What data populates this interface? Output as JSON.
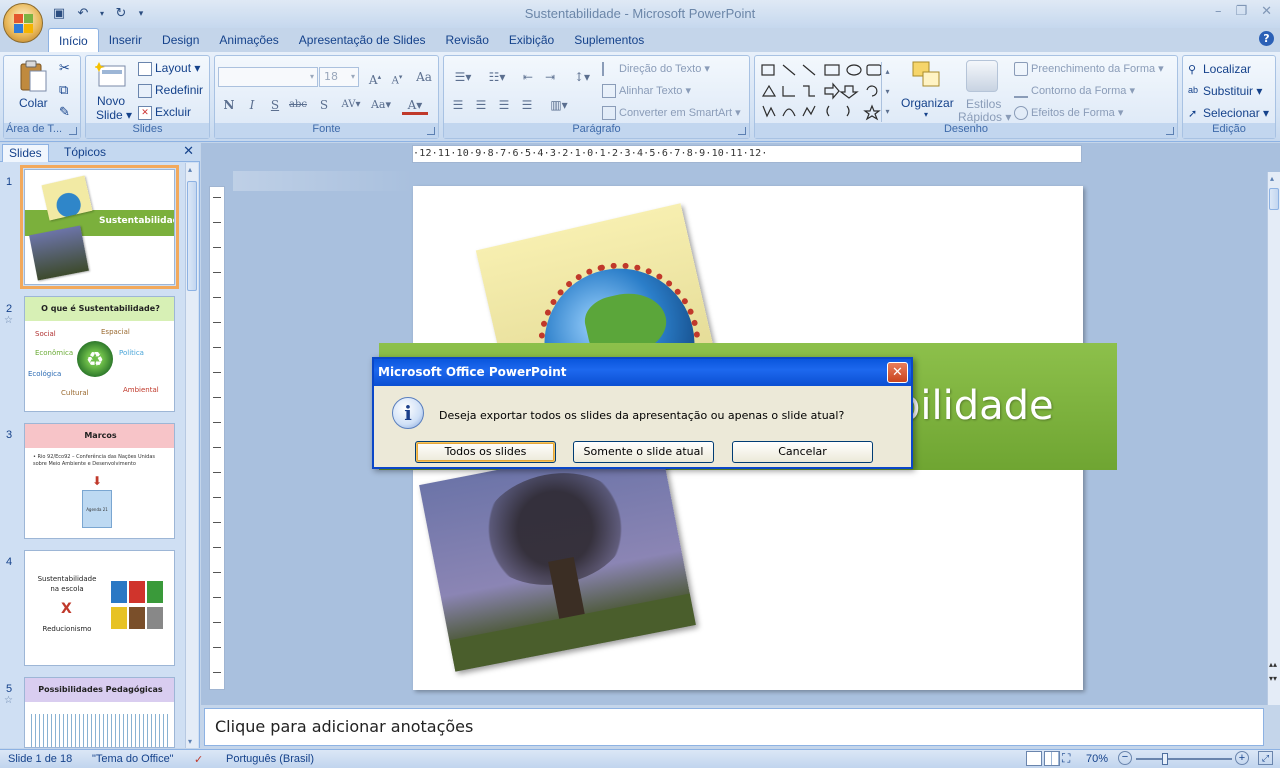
{
  "window": {
    "title": "Sustentabilidade - Microsoft PowerPoint"
  },
  "ribbon_tabs": [
    "Início",
    "Inserir",
    "Design",
    "Animações",
    "Apresentação de Slides",
    "Revisão",
    "Exibição",
    "Suplementos"
  ],
  "clipboard": {
    "paste_label": "Colar",
    "group_label": "Área de T..."
  },
  "slides_group": {
    "new_slide_line1": "Novo",
    "new_slide_line2": "Slide",
    "layout": "Layout",
    "reset": "Redefinir",
    "delete": "Excluir",
    "group_label": "Slides"
  },
  "font_group": {
    "font_size": "18",
    "group_label": "Fonte"
  },
  "paragraph_group": {
    "text_direction": "Direção do Texto",
    "align_text": "Alinhar Texto",
    "smartart": "Converter em SmartArt",
    "group_label": "Parágrafo"
  },
  "drawing_group": {
    "arrange": "Organizar",
    "quick_styles_line1": "Estilos",
    "quick_styles_line2": "Rápidos",
    "shape_fill": "Preenchimento da Forma",
    "shape_outline": "Contorno da Forma",
    "shape_effects": "Efeitos de Forma",
    "group_label": "Desenho"
  },
  "editing_group": {
    "find": "Localizar",
    "replace": "Substituir",
    "select": "Selecionar",
    "group_label": "Edição"
  },
  "panel_tabs": {
    "slides": "Slides",
    "outline": "Tópicos"
  },
  "thumbnails": [
    {
      "num": "1",
      "title": "Sustentabilidade"
    },
    {
      "num": "2",
      "title": "O que é Sustentabilidade?",
      "words": [
        "Social",
        "Espacial",
        "Econômica",
        "Política",
        "Ecológica",
        "Cultural",
        "Ambiental"
      ]
    },
    {
      "num": "3",
      "title": "Marcos",
      "bullet": "Rio 92/Eco92 – Conferência das Nações Unidas sobre Meio Ambiente e Desenvolvimento",
      "box": "Agenda 21"
    },
    {
      "num": "4",
      "line1": "Sustentabilidade",
      "line2": "na escola",
      "x": "X",
      "line3": "Reducionismo"
    },
    {
      "num": "5",
      "title": "Possibilidades Pedagógicas"
    }
  ],
  "ruler": {
    "horizontal": "·12·11·10·9·8·7·6·5·4·3·2·1·0·1·2·3·4·5·6·7·8·9·10·11·12·"
  },
  "slide": {
    "title_visible": "bilidade"
  },
  "notes": {
    "placeholder": "Clique para adicionar anotações"
  },
  "statusbar": {
    "slide_info": "Slide 1 de 18",
    "theme": "\"Tema do Office\"",
    "language": "Português (Brasil)",
    "zoom": "70%"
  },
  "dialog": {
    "title": "Microsoft Office PowerPoint",
    "message": "Deseja exportar todos os slides da apresentação ou apenas o slide atual?",
    "buttons": [
      "Todos os slides",
      "Somente o slide atual",
      "Cancelar"
    ]
  },
  "colors": {
    "ribbon_text": "#15428b",
    "slide_green": "#7bb03c",
    "dialog_blue": "#0a56dd",
    "selection": "#f2a95c"
  }
}
